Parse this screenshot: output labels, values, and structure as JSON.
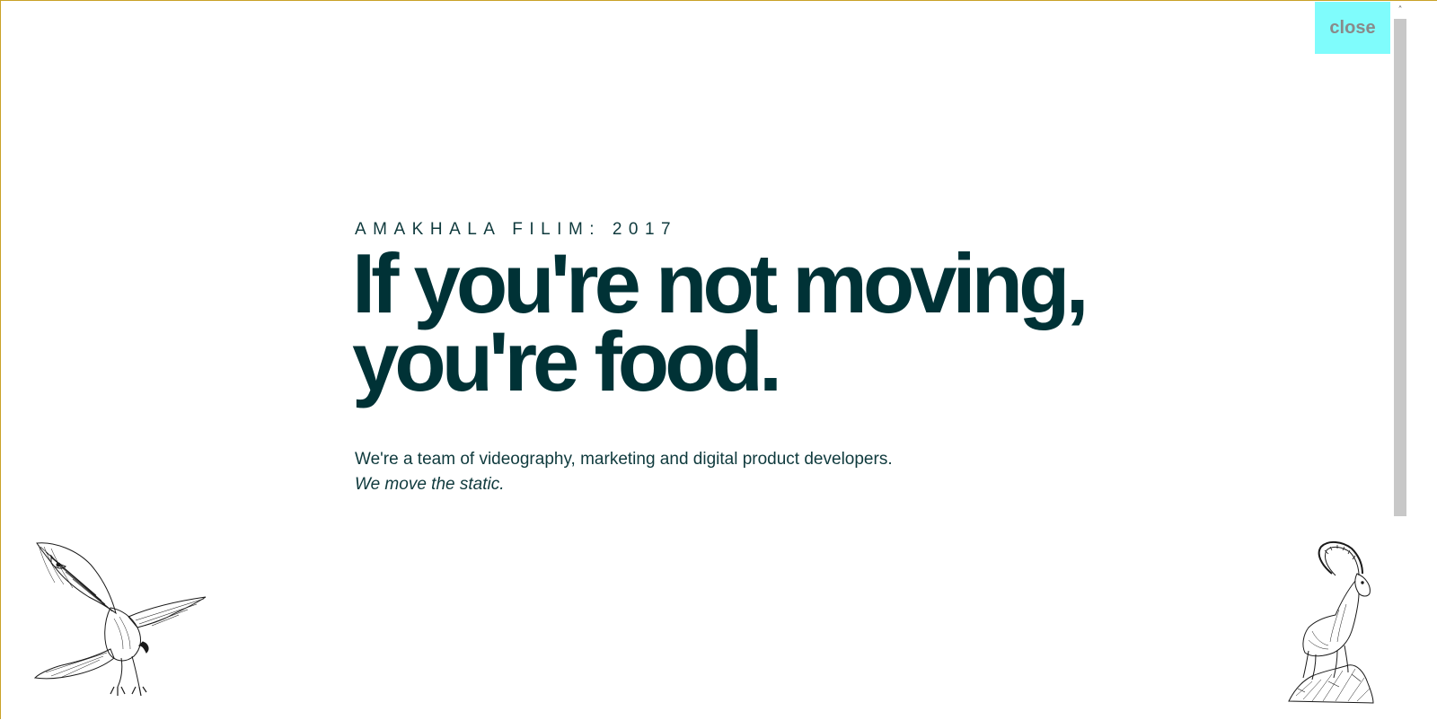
{
  "close_button": {
    "label": "close"
  },
  "hero": {
    "kicker": "AMAKHALA FILIM: 2017",
    "headline_line1": "If you're not moving,",
    "headline_line2": "you're food.",
    "description": "We're a team of videography, marketing and digital product developers.",
    "tagline": "We move the static."
  },
  "illustrations": {
    "left": "eagle-illustration",
    "right": "ibex-illustration"
  },
  "scrollbar": {
    "up_arrow": "˄"
  },
  "colors": {
    "text": "#003236",
    "close_bg": "#7ffcfc",
    "close_text": "#8a8a8a",
    "border": "#c9a227"
  }
}
